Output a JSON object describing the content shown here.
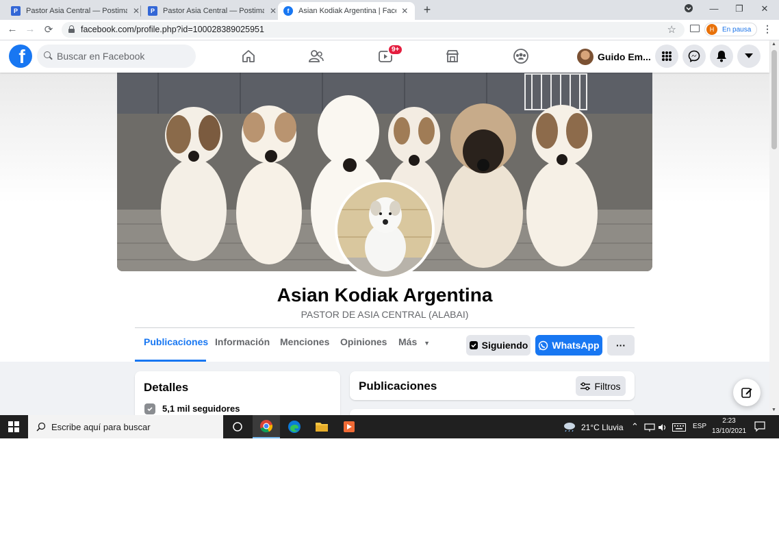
{
  "browser": {
    "tabs": [
      {
        "title": "Pastor Asia Central — Postimage",
        "favicon": "P"
      },
      {
        "title": "Pastor Asia Central — Postimage",
        "favicon": "P"
      },
      {
        "title": "Asian Kodiak Argentina | Facebook",
        "favicon": "f"
      }
    ],
    "new_tab": "+",
    "url": "facebook.com/profile.php?id=100028389025951",
    "profile": {
      "initial": "H",
      "status": "En pausa"
    }
  },
  "facebook": {
    "logo": "f",
    "search_placeholder": "Buscar en Facebook",
    "watch_badge": "9+",
    "user_name": "Guido Em..."
  },
  "page": {
    "name": "Asian Kodiak Argentina",
    "subtitle": "PASTOR DE ASIA CENTRAL (ALABAI)",
    "tabs": [
      "Publicaciones",
      "Información",
      "Menciones",
      "Opiniones",
      "Más"
    ],
    "active_tab": "Publicaciones",
    "following_label": "Siguiendo",
    "whatsapp_label": "WhatsApp",
    "more_label": "···"
  },
  "details": {
    "title": "Detalles",
    "followers": "5,1 mil seguidores"
  },
  "posts": {
    "title": "Publicaciones",
    "filters_label": "Filtros"
  },
  "taskbar": {
    "search_placeholder": "Escribe aquí para buscar",
    "weather": "21°C  Lluvia",
    "language": "ESP",
    "time": "2:23",
    "date": "13/10/2021"
  },
  "colors": {
    "fb_blue": "#1877f2",
    "badge_red": "#e41e3f",
    "taskbar": "#202020"
  }
}
